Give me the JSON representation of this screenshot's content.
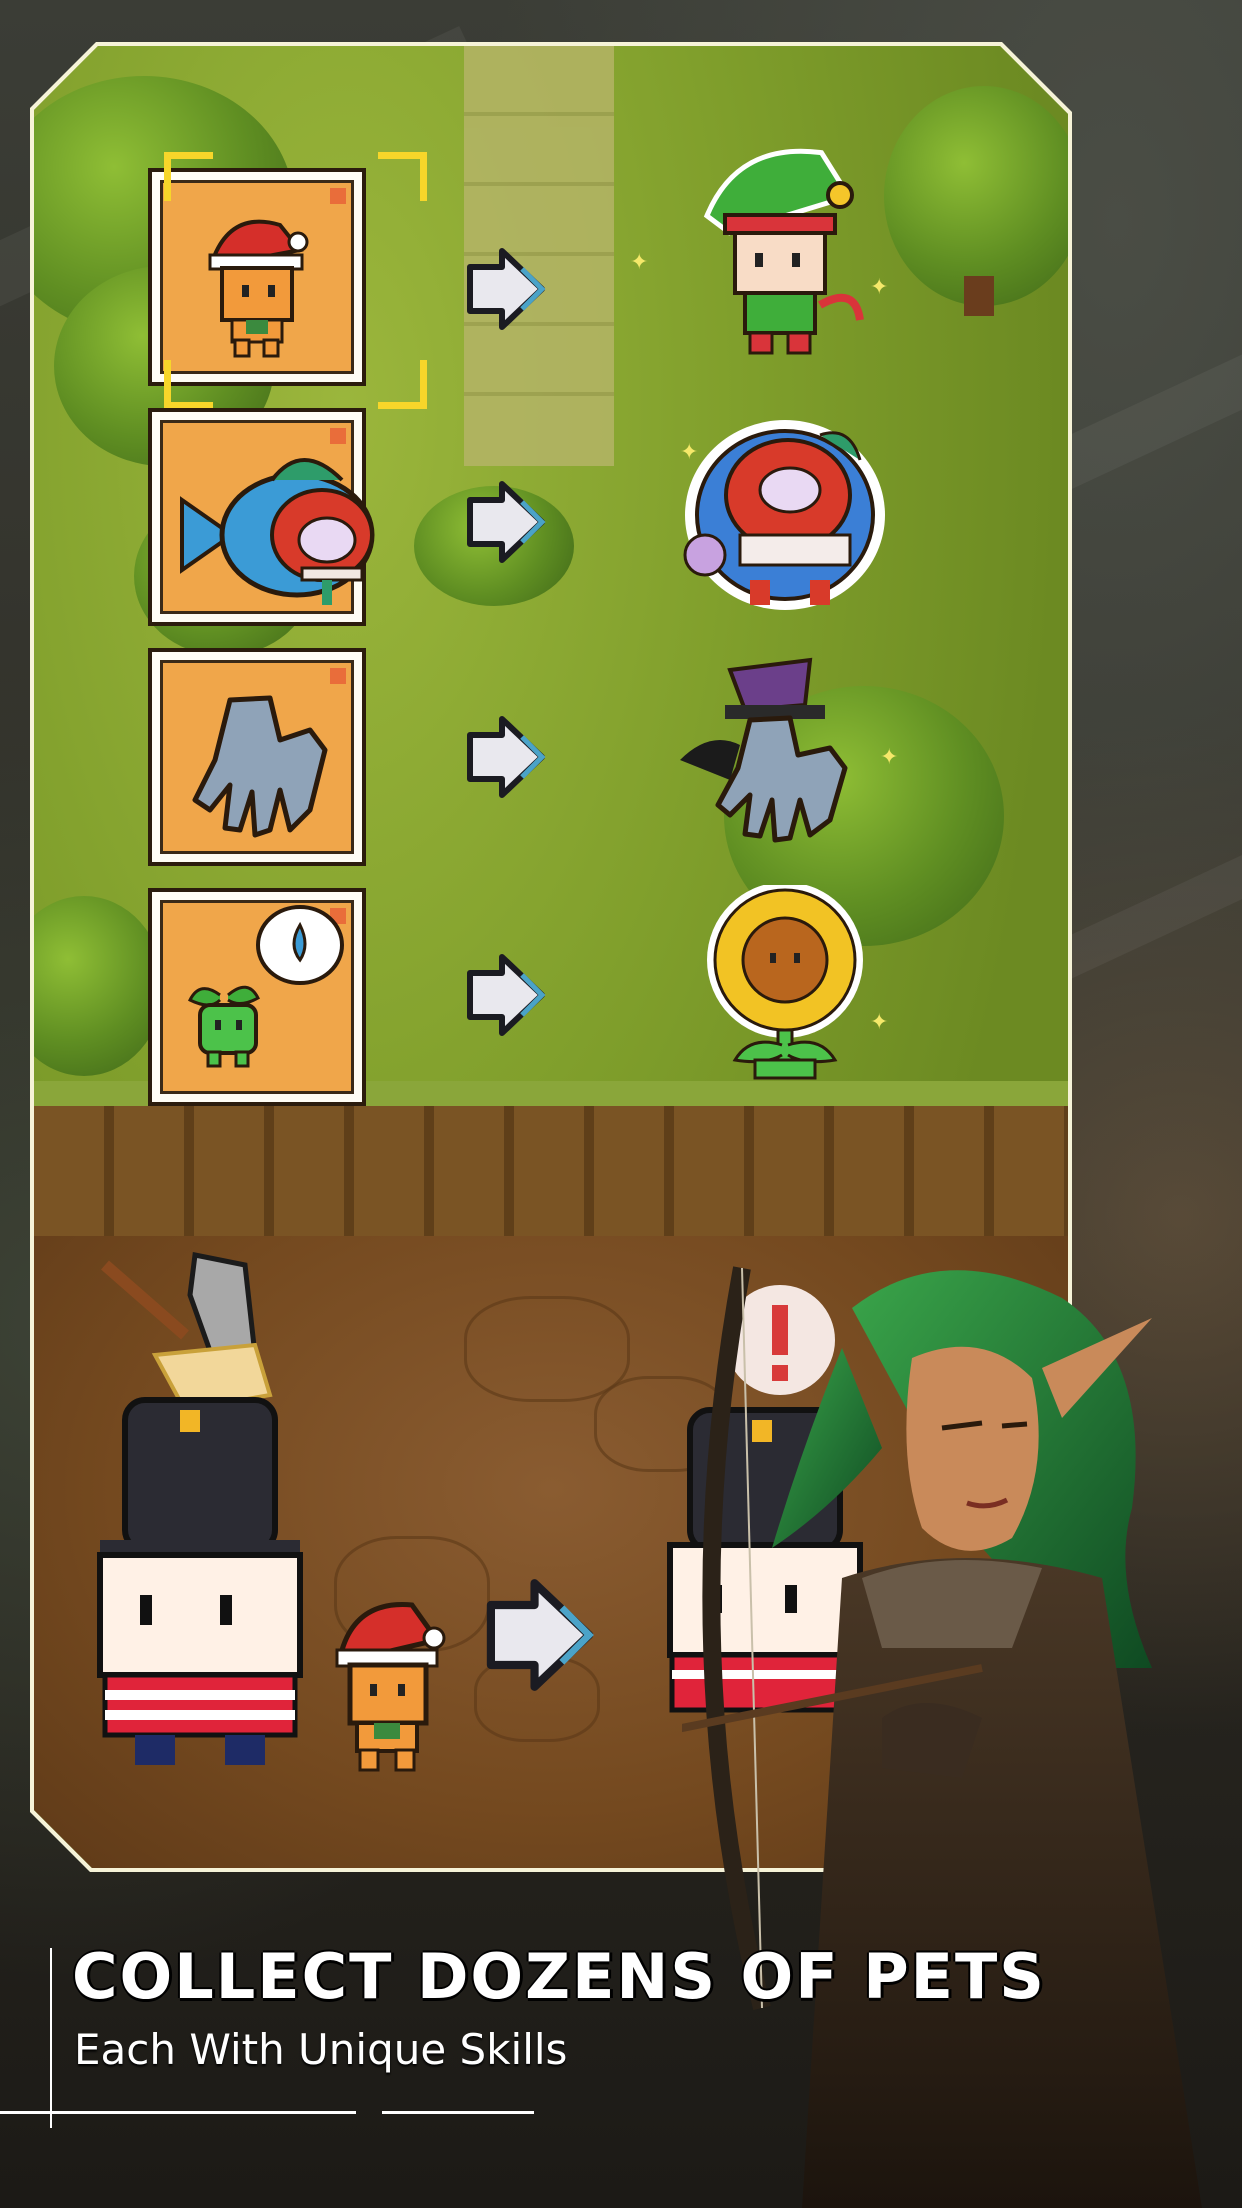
{
  "promo": {
    "title": "COLLECT DOZENS OF PETS",
    "subtitle": "Each With Unique Skills"
  },
  "pets": [
    {
      "base": "santa-hat-kid-icon",
      "evolved": "elf-icon",
      "selected": true
    },
    {
      "base": "fish-icon",
      "evolved": "lion-dance-icon",
      "selected": false
    },
    {
      "base": "grey-hand-icon",
      "evolved": "hat-hand-icon",
      "selected": false
    },
    {
      "base": "sprout-icon",
      "evolved": "sunflower-icon",
      "selected": false
    }
  ],
  "colors": {
    "frame": "#f6f3d8",
    "card_bg": "#f0a64a",
    "selection": "#f7d62a",
    "grass": "#7c9a2c",
    "dirt": "#74491f"
  }
}
